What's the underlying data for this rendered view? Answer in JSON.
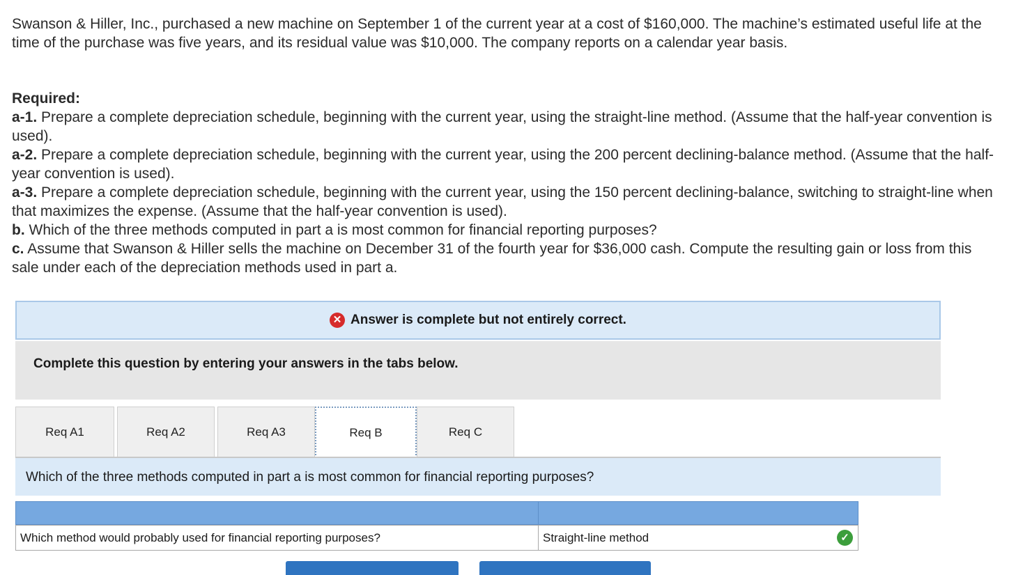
{
  "intro": "Swanson & Hiller, Inc., purchased a new machine on September 1 of the current year at a cost of $160,000. The machine’s estimated useful life at the time of the purchase was five years, and its residual value was $10,000. The company reports on a calendar year basis.",
  "required": {
    "heading": "Required:",
    "items": [
      {
        "label": "a-1.",
        "text": " Prepare a complete depreciation schedule, beginning with the current year, using the straight-line method. (Assume that the half-year convention is used)."
      },
      {
        "label": "a-2.",
        "text": " Prepare a complete depreciation schedule, beginning with the current year, using the 200 percent declining-balance method. (Assume that the half-year convention is used)."
      },
      {
        "label": "a-3.",
        "text": " Prepare a complete depreciation schedule, beginning with the current year, using the 150 percent declining-balance, switching to straight-line when that maximizes the expense. (Assume that the half-year convention is used)."
      },
      {
        "label": "b.",
        "text": " Which of the three methods computed in part a is most common for financial reporting purposes?"
      },
      {
        "label": "c.",
        "text": " Assume that Swanson & Hiller sells the machine on December 31 of the fourth year for $36,000 cash. Compute the resulting gain or loss from this sale under each of the depreciation methods used in part a."
      }
    ]
  },
  "banner": {
    "icon": "x-circle-icon",
    "text": "Answer is complete but not entirely correct."
  },
  "instruction": "Complete this question by entering your answers in the tabs below.",
  "tabs": [
    {
      "label": "Req A1"
    },
    {
      "label": "Req A2"
    },
    {
      "label": "Req A3"
    },
    {
      "label": "Req B",
      "active": true
    },
    {
      "label": "Req C"
    }
  ],
  "question": "Which of the three methods computed in part a is most common for financial reporting purposes?",
  "answer_table": {
    "row_label": "Which method would probably used for financial reporting purposes?",
    "answer": "Straight-line method",
    "answer_status_icon": "check-circle-icon"
  },
  "colors": {
    "banner_bg": "#dbeaf8",
    "header_blue": "#76a8e0",
    "button_blue": "#2f74c0",
    "error_red": "#d62b2b",
    "correct_green": "#3c9e3c"
  }
}
